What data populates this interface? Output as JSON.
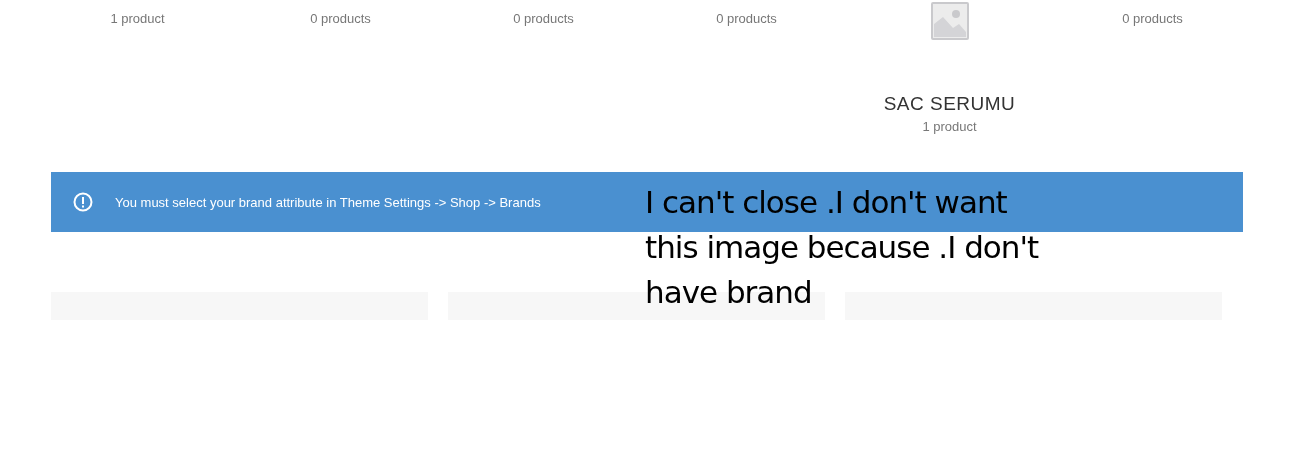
{
  "categories": [
    {
      "kind": "plain",
      "count": "1 product"
    },
    {
      "kind": "plain",
      "count": "0 products"
    },
    {
      "kind": "plain",
      "count": "0 products"
    },
    {
      "kind": "plain",
      "count": "0 products"
    },
    {
      "kind": "with-image",
      "title": "SAC SERUMU",
      "count": "1 product"
    },
    {
      "kind": "plain",
      "count": "0 products"
    }
  ],
  "notice": {
    "message": "You must select your brand attribute in Theme Settings -> Shop -> Brands"
  },
  "annotation": "I can't close .I don't want this image because .I don't have brand"
}
